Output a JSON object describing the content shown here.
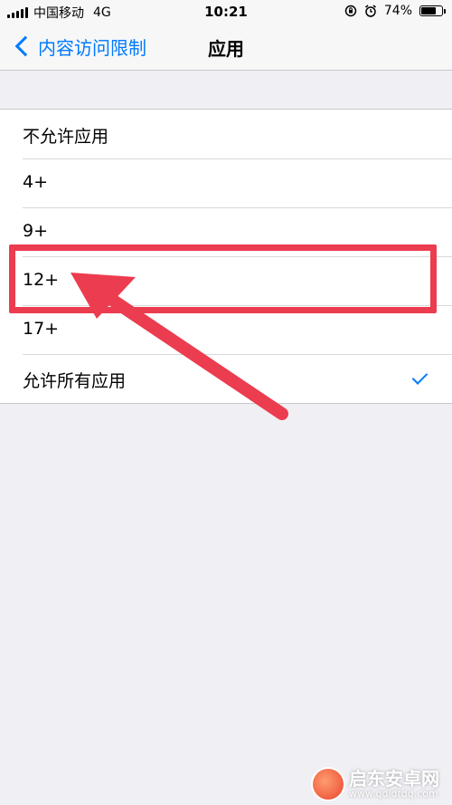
{
  "status_bar": {
    "carrier": "中国移动",
    "network": "4G",
    "time": "10:21",
    "battery": "74%",
    "battery_level": 0.74
  },
  "nav": {
    "back_label": "内容访问限制",
    "title": "应用"
  },
  "options": [
    {
      "label": "不允许应用",
      "checked": false
    },
    {
      "label": "4+",
      "checked": false
    },
    {
      "label": "9+",
      "checked": false
    },
    {
      "label": "12+",
      "checked": false,
      "highlighted": true
    },
    {
      "label": "17+",
      "checked": false
    },
    {
      "label": "允许所有应用",
      "checked": true
    }
  ],
  "colors": {
    "accent": "#007aff",
    "annotation": "#ec3c4f",
    "background": "#efeff4"
  },
  "watermark": {
    "name": "启东安卓网",
    "url": "www.qdldtdq.com"
  }
}
